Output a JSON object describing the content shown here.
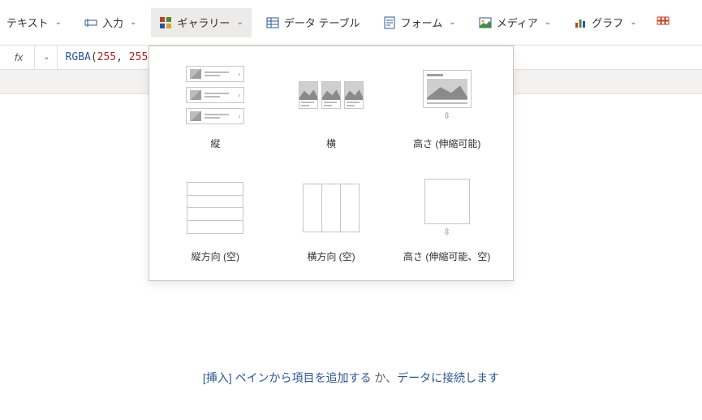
{
  "ribbon": {
    "text": {
      "label": "テキスト"
    },
    "input": {
      "label": "入力"
    },
    "gallery": {
      "label": "ギャラリー"
    },
    "datatable": {
      "label": "データ テーブル"
    },
    "form": {
      "label": "フォーム"
    },
    "media": {
      "label": "メディア"
    },
    "chart": {
      "label": "グラフ"
    }
  },
  "formula": {
    "fx": "fx",
    "fn": "RGBA",
    "open": "(",
    "arg1": "255",
    "comma": ", ",
    "arg2_partial": "255"
  },
  "gallery_options": {
    "vertical": "縦",
    "horizontal": "横",
    "flex_height": "高さ (伸縮可能)",
    "vertical_empty": "縦方向 (空)",
    "horizontal_empty": "横方向 (空)",
    "flex_height_empty": "高さ (伸縮可能、空)"
  },
  "helper": {
    "link1": "[挿入] ペインから項目を追加する",
    "mid": " か、",
    "link2": "データに接続します"
  }
}
